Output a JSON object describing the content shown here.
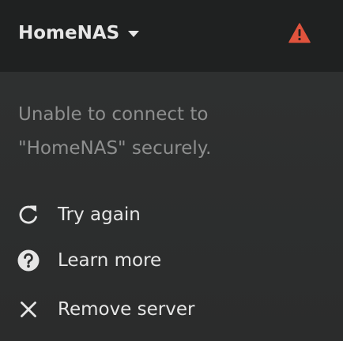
{
  "header": {
    "server_name": "HomeNAS",
    "warning_color": "#e0533d"
  },
  "message": {
    "line1": "Unable to connect to",
    "line2": "\"HomeNAS\" securely."
  },
  "actions": [
    {
      "label": "Try again",
      "icon": "refresh-icon"
    },
    {
      "label": "Learn more",
      "icon": "help-circle-icon"
    },
    {
      "label": "Remove server",
      "icon": "close-icon"
    }
  ]
}
